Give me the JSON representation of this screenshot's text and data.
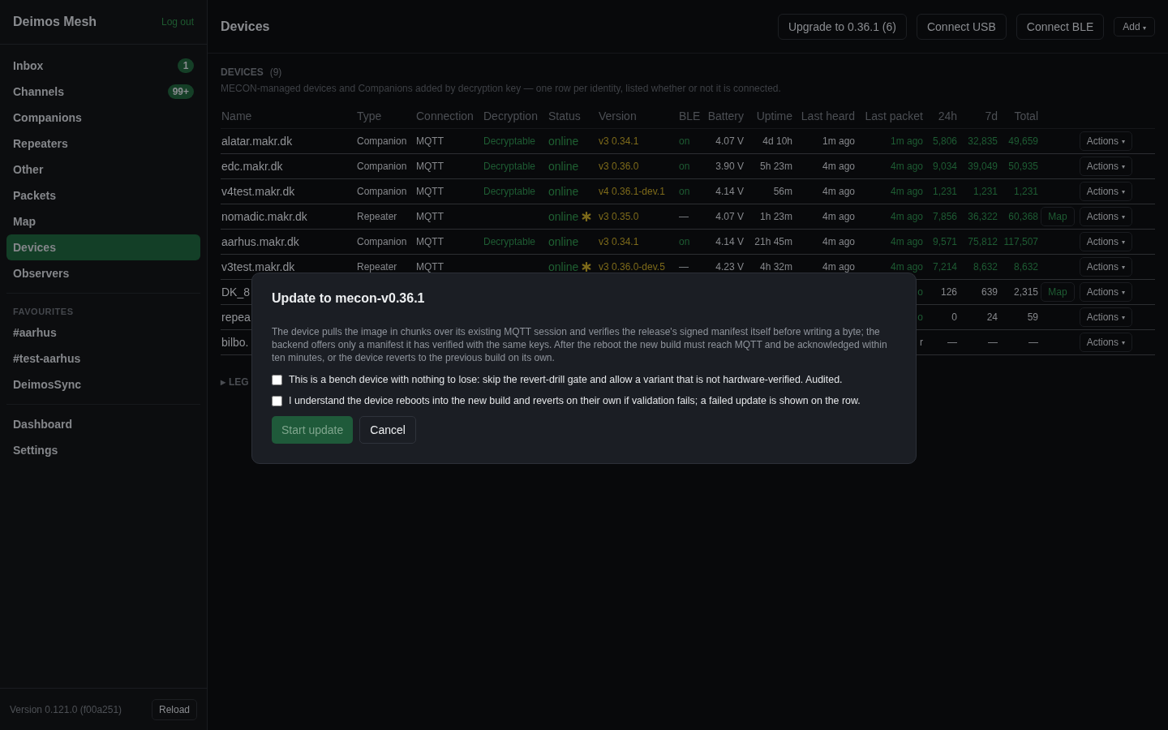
{
  "sidebar": {
    "brand": "Deimos Mesh",
    "logout": "Log out",
    "nav": [
      {
        "label": "Inbox",
        "badge": "1",
        "selected": false
      },
      {
        "label": "Channels",
        "badge": "99+",
        "selected": false
      },
      {
        "label": "Companions",
        "selected": false
      },
      {
        "label": "Repeaters",
        "selected": false
      },
      {
        "label": "Other",
        "selected": false
      },
      {
        "label": "Packets",
        "selected": false
      },
      {
        "label": "Map",
        "selected": false
      },
      {
        "label": "Devices",
        "selected": true
      },
      {
        "label": "Observers",
        "selected": false
      }
    ],
    "favourites_heading": "FAVOURITES",
    "favourites": [
      {
        "label": "#aarhus",
        "selected": false
      },
      {
        "label": "#test-aarhus",
        "selected": false
      },
      {
        "label": "DeimosSync",
        "selected": false
      }
    ],
    "bottom": [
      {
        "label": "Dashboard",
        "selected": false
      },
      {
        "label": "Settings",
        "selected": false
      }
    ],
    "version": "Version 0.121.0 (f00a251)",
    "reload": "Reload"
  },
  "header": {
    "title": "Devices",
    "buttons": [
      "Upgrade to 0.36.1 (6)",
      "Connect USB",
      "Connect BLE"
    ],
    "add": "Add",
    "add_caret": "▾"
  },
  "section": {
    "heading": "DEVICES",
    "count": "(9)",
    "description": "MECON-managed devices and Companions added by decryption key — one row per identity, listed whether or not it is connected."
  },
  "table": {
    "columns": [
      "Name",
      "Type",
      "Connection",
      "Decryption",
      "Status",
      "Version",
      "BLE",
      "Battery",
      "Uptime",
      "Last heard",
      "Last packet",
      "24h",
      "7d",
      "Total"
    ],
    "rows": [
      {
        "name": "alatar.makr.dk",
        "type": "Companion",
        "connection": "MQTT",
        "decryption": "Decryptable",
        "status": "online",
        "flagged": false,
        "version": "v3 0.34.1",
        "ble": "on",
        "ble_on": true,
        "battery": "4.07 V",
        "uptime": "4d 10h",
        "last_heard": "1m ago",
        "last_packet": "1m ago",
        "recent": true,
        "c24h": "5,806",
        "c7d": "32,835",
        "total": "49,659",
        "counts_active": true,
        "actions": "Actions"
      },
      {
        "name": "edc.makr.dk",
        "type": "Companion",
        "connection": "MQTT",
        "decryption": "Decryptable",
        "status": "online",
        "flagged": false,
        "version": "v3 0.36.0",
        "ble": "on",
        "ble_on": true,
        "battery": "3.90 V",
        "uptime": "5h 23m",
        "last_heard": "4m ago",
        "last_packet": "4m ago",
        "recent": true,
        "c24h": "9,034",
        "c7d": "39,049",
        "total": "50,935",
        "counts_active": true,
        "actions": "Actions"
      },
      {
        "name": "v4test.makr.dk",
        "type": "Companion",
        "connection": "MQTT",
        "decryption": "Decryptable",
        "status": "online",
        "flagged": false,
        "version": "v4 0.36.1-dev.1",
        "ble": "on",
        "ble_on": true,
        "battery": "4.14 V",
        "uptime": "56m",
        "last_heard": "4m ago",
        "last_packet": "4m ago",
        "recent": true,
        "c24h": "1,231",
        "c7d": "1,231",
        "total": "1,231",
        "counts_active": true,
        "actions": "Actions"
      },
      {
        "name": "nomadic.makr.dk",
        "type": "Repeater",
        "connection": "MQTT",
        "status": "online",
        "flagged": true,
        "version": "v3 0.35.0",
        "ble": "—",
        "ble_on": false,
        "battery": "4.07 V",
        "uptime": "1h 23m",
        "last_heard": "4m ago",
        "last_packet": "4m ago",
        "recent": true,
        "c24h": "7,856",
        "c7d": "36,322",
        "total": "60,368",
        "counts_active": true,
        "map": "Map",
        "actions": "Actions"
      },
      {
        "name": "aarhus.makr.dk",
        "type": "Companion",
        "connection": "MQTT",
        "decryption": "Decryptable",
        "status": "online",
        "flagged": false,
        "version": "v3 0.34.1",
        "ble": "on",
        "ble_on": true,
        "battery": "4.14 V",
        "uptime": "21h 45m",
        "last_heard": "4m ago",
        "last_packet": "4m ago",
        "recent": true,
        "c24h": "9,571",
        "c7d": "75,812",
        "total": "117,507",
        "counts_active": true,
        "actions": "Actions"
      },
      {
        "name": "v3test.makr.dk",
        "type": "Repeater",
        "connection": "MQTT",
        "status": "online",
        "flagged": true,
        "version": "v3 0.36.0-dev.5",
        "ble": "—",
        "ble_on": false,
        "battery": "4.23 V",
        "uptime": "4h 32m",
        "last_heard": "4m ago",
        "last_packet": "4m ago",
        "recent": true,
        "c24h": "7,214",
        "c7d": "8,632",
        "total": "8,632",
        "counts_active": true,
        "actions": "Actions"
      },
      {
        "name": "DK_8",
        "last_packet": "o",
        "recent": true,
        "c24h": "126",
        "c7d": "639",
        "total": "2,315",
        "counts_active": false,
        "map": "Map",
        "actions": "Actions"
      },
      {
        "name": "repea",
        "last_packet": "o",
        "recent": true,
        "c24h": "0",
        "c7d": "24",
        "total": "59",
        "counts_active": false,
        "actions": "Actions"
      },
      {
        "name": "bilbo.",
        "last_packet": "r",
        "recent": false,
        "c24h": "—",
        "c7d": "—",
        "total": "—",
        "counts_active": false,
        "actions": "Actions"
      }
    ]
  },
  "legend": {
    "toggle": "▸",
    "label": "LEG"
  },
  "dialog": {
    "title": "Update to mecon-v0.36.1",
    "body": "The device pulls the image in chunks over its existing MQTT session and verifies the release's signed manifest itself before writing a byte; the backend offers only a manifest it has verified with the same keys. After the reboot the new build must reach MQTT and be acknowledged within ten minutes, or the device reverts to the previous build on its own.",
    "options": [
      {
        "label": "This is a bench device with nothing to lose: skip the revert-drill gate and allow a variant that is not hardware-verified. Audited.",
        "checked": false
      },
      {
        "label": "I understand the device reboots into the new build and reverts on their own if validation fails; a failed update is shown on the row.",
        "checked": false
      }
    ],
    "confirm": {
      "label": "Start update",
      "disabled": true
    },
    "cancel": "Cancel"
  }
}
